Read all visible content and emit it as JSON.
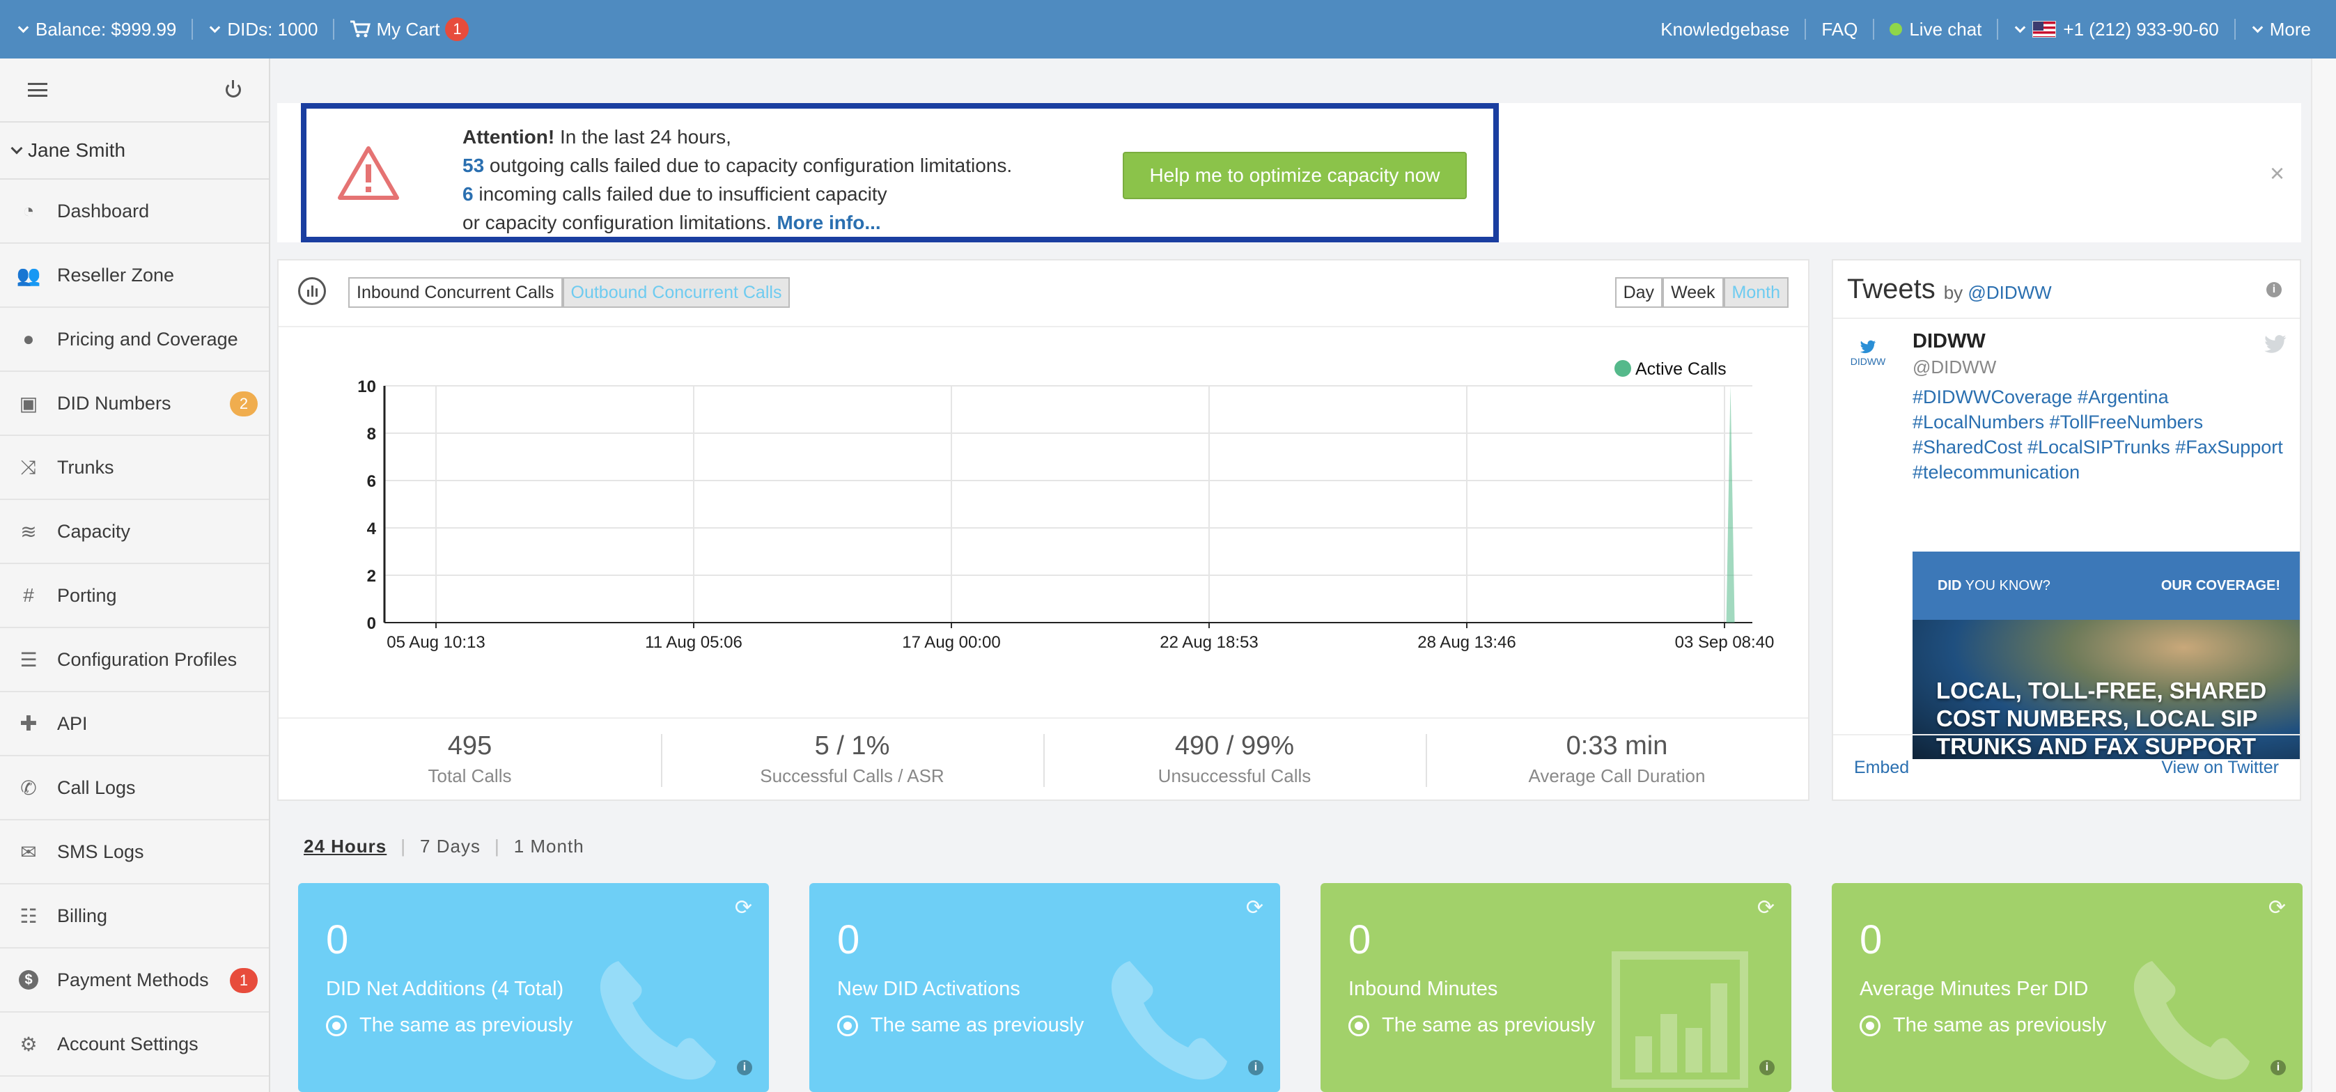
{
  "topbar": {
    "balance": "Balance: $999.99",
    "dids": "DIDs: 1000",
    "cart": "My Cart",
    "cart_count": "1",
    "knowledgebase": "Knowledgebase",
    "faq": "FAQ",
    "live_chat": "Live chat",
    "phone": "+1 (212) 933-90-60",
    "more": "More"
  },
  "sidebar": {
    "user": "Jane Smith",
    "items": [
      {
        "label": "Dashboard",
        "icon": "dashboard-icon"
      },
      {
        "label": "Reseller Zone",
        "icon": "users-icon"
      },
      {
        "label": "Pricing and Coverage",
        "icon": "globe-icon"
      },
      {
        "label": "DID Numbers",
        "icon": "briefcase-icon",
        "badge": "2"
      },
      {
        "label": "Trunks",
        "icon": "shuffle-icon"
      },
      {
        "label": "Capacity",
        "icon": "database-icon"
      },
      {
        "label": "Porting",
        "icon": "hashtag-icon"
      },
      {
        "label": "Configuration Profiles",
        "icon": "sliders-icon"
      },
      {
        "label": "API",
        "icon": "puzzle-icon"
      },
      {
        "label": "Call Logs",
        "icon": "phone-icon"
      },
      {
        "label": "SMS Logs",
        "icon": "envelope-icon"
      },
      {
        "label": "Billing",
        "icon": "list-icon"
      },
      {
        "label": "Payment Methods",
        "icon": "dollar-icon",
        "badge": "1"
      },
      {
        "label": "Account Settings",
        "icon": "cogs-icon"
      }
    ]
  },
  "alert": {
    "title": "Attention!",
    "line1": " In the last 24 hours,",
    "outgoing_count": "53",
    "line2": " outgoing calls failed due to capacity configuration limitations.",
    "incoming_count": "6",
    "line3": " incoming calls failed due to insufficient capacity",
    "line4": "or capacity configuration limitations. ",
    "more_info": "More info...",
    "button": "Help me to optimize capacity now",
    "close": "×"
  },
  "chart_panel": {
    "tab_inbound": "Inbound Concurrent Calls",
    "tab_outbound": "Outbound Concurrent Calls",
    "range_day": "Day",
    "range_week": "Week",
    "range_month": "Month"
  },
  "chart_data": {
    "type": "area",
    "series": [
      {
        "name": "Active Calls",
        "color": "#55b98b"
      }
    ],
    "x_ticks": [
      "05 Aug 10:13",
      "11 Aug 05:06",
      "17 Aug 00:00",
      "22 Aug 18:53",
      "28 Aug 13:46",
      "03 Sep 08:40"
    ],
    "y_ticks": [
      0,
      2,
      4,
      6,
      8,
      10
    ],
    "ylim": [
      0,
      10
    ],
    "spike": {
      "x_fraction": 0.984,
      "value": 10
    },
    "legend_position": "top-right",
    "grid": true
  },
  "stats": [
    {
      "value": "495",
      "label": "Total Calls"
    },
    {
      "value": "5 / 1%",
      "label": "Successful Calls / ASR"
    },
    {
      "value": "490 / 99%",
      "label": "Unsuccessful Calls"
    },
    {
      "value": "0:33 min",
      "label": "Average Call Duration"
    }
  ],
  "tweets": {
    "title": "Tweets",
    "by": "by",
    "handle_link": "@DIDWW",
    "logo_text": "DIDWW",
    "name": "DIDWW",
    "handle": "@DIDWW",
    "text": "#DIDWWCoverage #Argentina #LocalNumbers #TollFreeNumbers #SharedCost #LocalSIPTrunks #FaxSupport #telecommunication",
    "img_left_bold": "DID",
    "img_left": " YOU KNOW?",
    "img_right": "OUR COVERAGE!",
    "img_caption": "LOCAL, TOLL-FREE, SHARED COST NUMBERS, LOCAL SIP TRUNKS AND FAX SUPPORT",
    "embed": "Embed",
    "view": "View on Twitter"
  },
  "period": {
    "h24": "24 Hours",
    "d7": "7 Days",
    "m1": "1 Month",
    "sep": "|"
  },
  "cards": [
    {
      "value": "0",
      "title": "DID Net Additions (4 Total)",
      "status": "The same as previously",
      "icon": "phone-icon",
      "color": "#6ecff6"
    },
    {
      "value": "0",
      "title": "New DID Activations",
      "status": "The same as previously",
      "icon": "phone-icon",
      "color": "#6ecff6"
    },
    {
      "value": "0",
      "title": "Inbound Minutes",
      "status": "The same as previously",
      "icon": "bar-chart-icon",
      "color": "#a2d16a"
    },
    {
      "value": "0",
      "title": "Average Minutes Per DID",
      "status": "The same as previously",
      "icon": "phone-icon",
      "color": "#a2d16a"
    }
  ]
}
